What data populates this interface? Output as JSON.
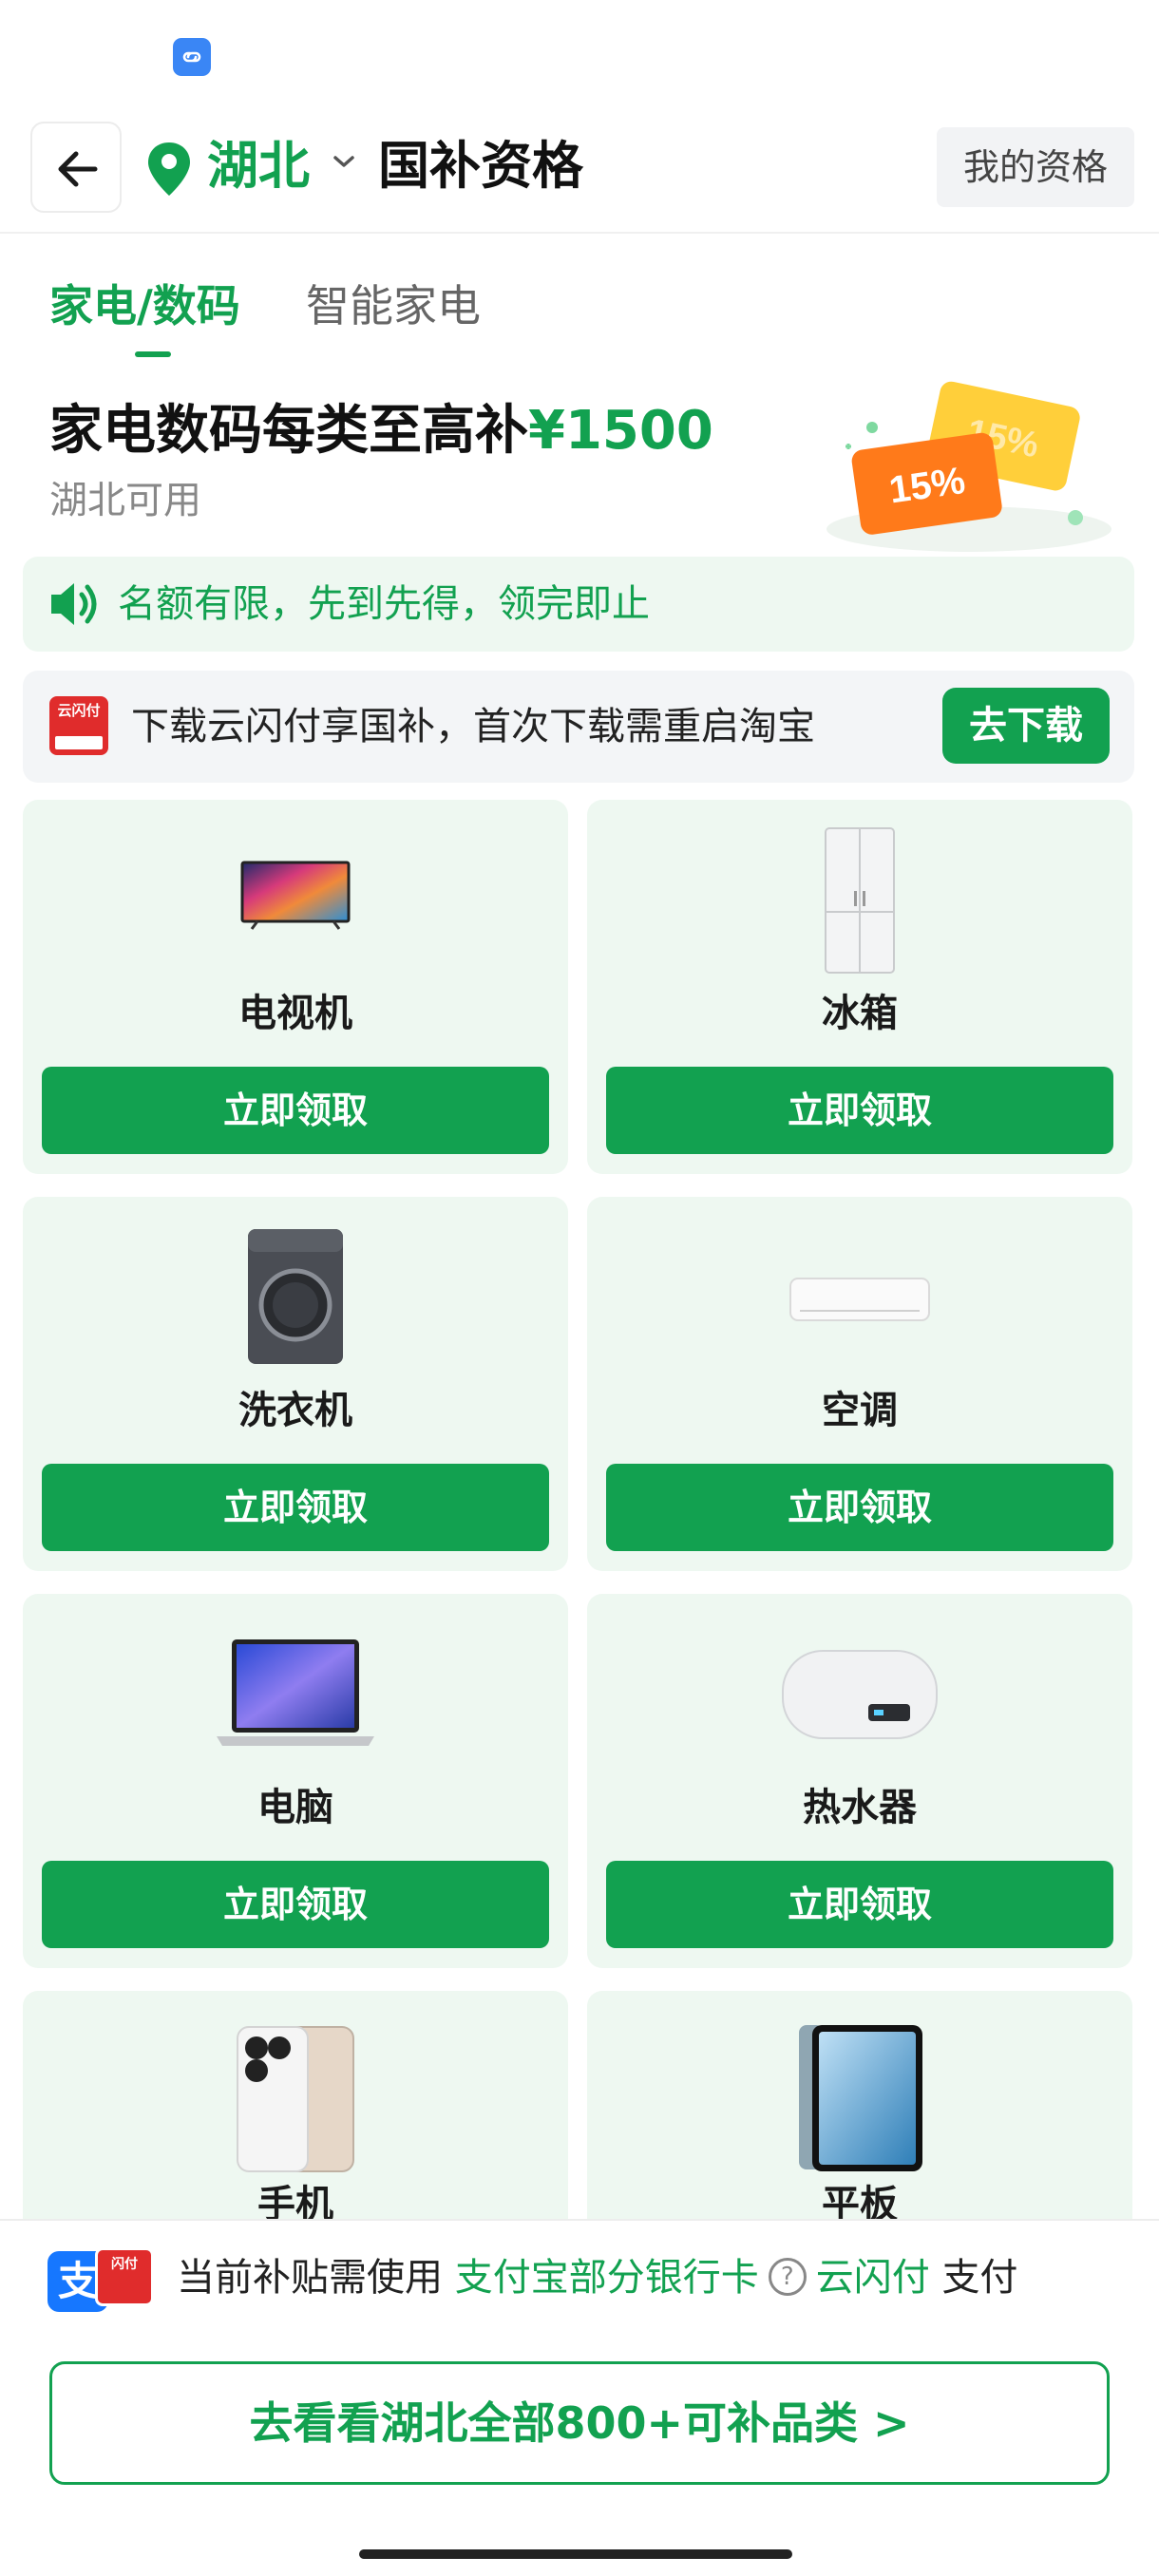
{
  "status": {
    "app_icon": "link-app-icon"
  },
  "header": {
    "back_icon": "arrow-left-icon",
    "region": "湖北",
    "title": "国补资格",
    "my_qualification": "我的资格"
  },
  "tabs": [
    {
      "label": "家电/数码",
      "active": true
    },
    {
      "label": "智能家电",
      "active": false
    }
  ],
  "promo": {
    "title_prefix": "家电数码每类至高补",
    "amount": "¥1500",
    "subtitle": "湖北可用",
    "coupon_front": "15%",
    "coupon_back": "15%"
  },
  "notice": {
    "icon": "speaker-icon",
    "text": "名额有限，先到先得，领完即止"
  },
  "download": {
    "icon_label": "云闪付",
    "icon_sub": "UnionPay",
    "text": "下载云闪付享国补，首次下载需重启淘宝",
    "button": "去下载"
  },
  "products": [
    {
      "name": "电视机",
      "icon": "tv-icon",
      "claim": "立即领取"
    },
    {
      "name": "冰箱",
      "icon": "fridge-icon",
      "claim": "立即领取"
    },
    {
      "name": "洗衣机",
      "icon": "washing-machine-icon",
      "claim": "立即领取"
    },
    {
      "name": "空调",
      "icon": "air-conditioner-icon",
      "claim": "立即领取"
    },
    {
      "name": "电脑",
      "icon": "laptop-icon",
      "claim": "立即领取"
    },
    {
      "name": "热水器",
      "icon": "water-heater-icon",
      "claim": "立即领取"
    },
    {
      "name": "手机",
      "icon": "phone-icon",
      "claim": ""
    },
    {
      "name": "平板",
      "icon": "tablet-icon",
      "claim": ""
    }
  ],
  "bottom": {
    "alipay_glyph": "支",
    "unionpay_label": "闪付",
    "pay_prefix": "当前补贴需使用",
    "alipay_link": "支付宝部分银行卡",
    "help": "?",
    "unionpay_link": "云闪付",
    "pay_suffix": "支付",
    "see_all": "去看看湖北全部800+可补品类 >"
  },
  "colors": {
    "accent": "#12a150",
    "card_bg": "#eef8f1",
    "notice_bg": "#eef8f1"
  }
}
